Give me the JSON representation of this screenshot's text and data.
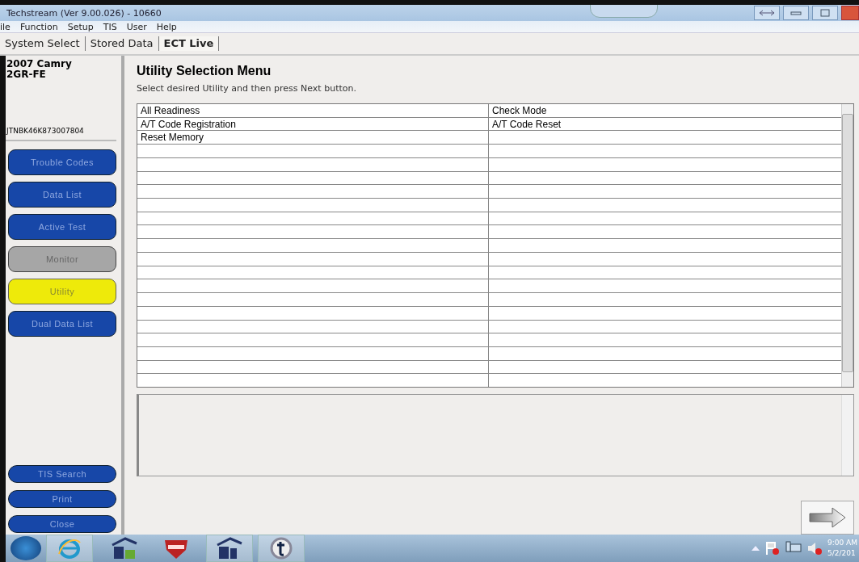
{
  "window": {
    "title": "Techstream (Ver 9.00.026) - 10660"
  },
  "menu": [
    "ile",
    "Function",
    "Setup",
    "TIS",
    "User",
    "Help"
  ],
  "tabs": [
    {
      "label": "System Select",
      "selected": false
    },
    {
      "label": "Stored Data",
      "selected": false
    },
    {
      "label": "ECT Live",
      "selected": true
    }
  ],
  "vehicle": {
    "model": "2007 Camry",
    "engine": "2GR-FE",
    "vin": "JTNBK46K873007804"
  },
  "nav": [
    {
      "label": "Trouble Codes",
      "selected": false,
      "disabled": false
    },
    {
      "label": "Data List",
      "selected": false,
      "disabled": false
    },
    {
      "label": "Active Test",
      "selected": false,
      "disabled": false
    },
    {
      "label": "Monitor",
      "selected": false,
      "disabled": true
    },
    {
      "label": "Utility",
      "selected": true,
      "disabled": false
    },
    {
      "label": "Dual Data List",
      "selected": false,
      "disabled": false
    }
  ],
  "bottom_buttons": [
    "TIS Search",
    "Print",
    "Close"
  ],
  "content": {
    "heading": "Utility Selection Menu",
    "instruction": "Select desired Utility and then press Next button."
  },
  "table": {
    "rows": [
      [
        "All Readiness",
        "Check Mode"
      ],
      [
        "A/T Code Registration",
        "A/T Code Reset"
      ],
      [
        "Reset Memory"
      ]
    ]
  },
  "clock": {
    "time": "9:00 AM",
    "date": "5/2/201"
  }
}
